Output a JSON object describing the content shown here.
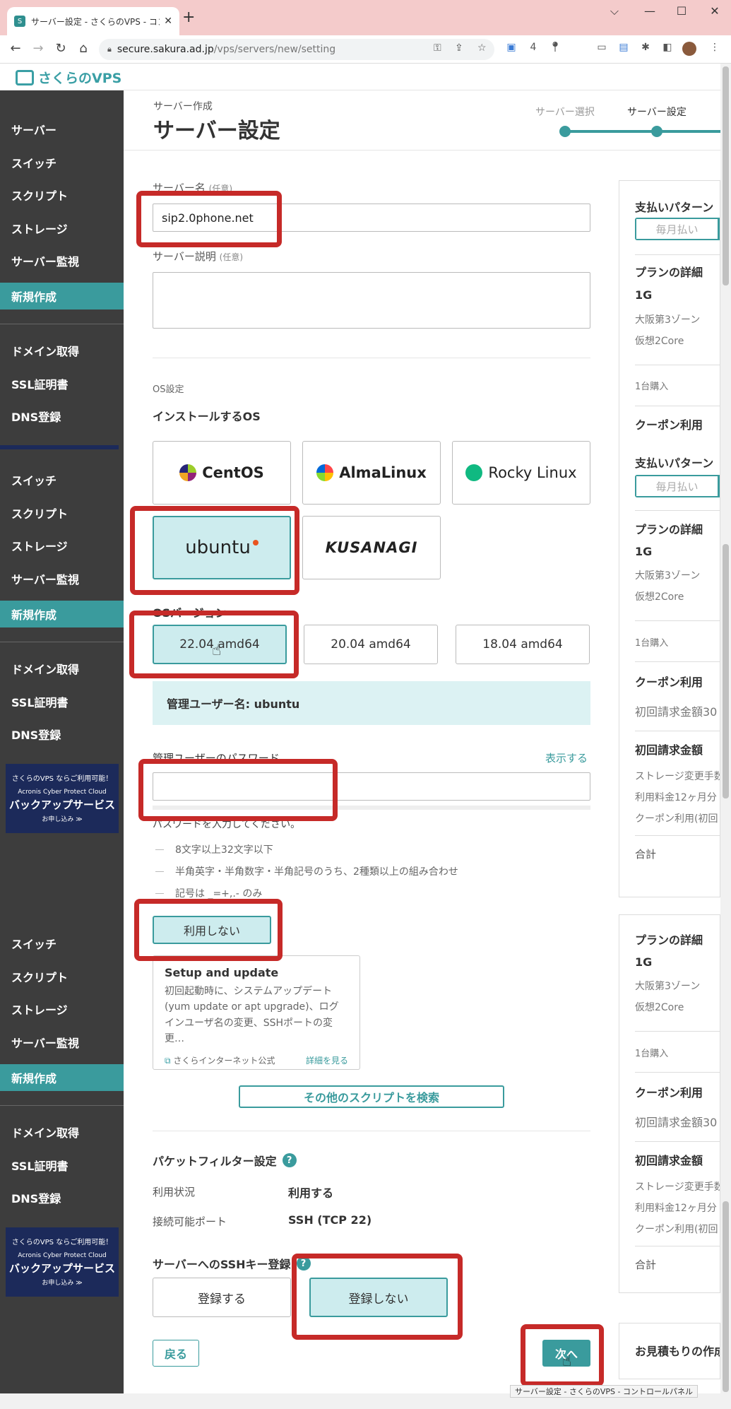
{
  "browser": {
    "tab_title": "サーバー設定 - さくらのVPS - コントロ...",
    "favicon_text": "S",
    "url_host": "secure.sakura.ad.jp",
    "url_path": "/vps/servers/new/setting",
    "new_tab": "+",
    "close": "✕",
    "min": "⌵",
    "minimize": "—",
    "maximize": "☐",
    "exit": "✕"
  },
  "site": {
    "logo": "さくらのVPS"
  },
  "sidebar": {
    "items": [
      "サーバー",
      "スイッチ",
      "スクリプト",
      "ストレージ",
      "サーバー監視",
      "新規作成",
      "ドメイン取得",
      "SSL証明書",
      "DNS登録"
    ],
    "banner": {
      "line1": "さくらのVPS ならご利用可能！",
      "line2": "Acronis Cyber Protect Cloud",
      "line3": "バックアップサービス",
      "line4": "お申し込み ≫"
    }
  },
  "header": {
    "subtitle": "サーバー作成",
    "title": "サーバー設定",
    "steps": [
      "サーバー選択",
      "サーバー設定"
    ]
  },
  "form": {
    "server_name_label": "サーバー名",
    "optional": "(任意)",
    "server_name_value": "sip2.0phone.net",
    "server_desc_label": "サーバー説明",
    "os_section": "OS設定",
    "os_install_label": "インストールするOS",
    "os_options": [
      "CentOS",
      "AlmaLinux",
      "Rocky Linux",
      "ubuntu",
      "KUSANAGI"
    ],
    "os_version_label": "OSバージョン",
    "os_versions": [
      "22.04 amd64",
      "20.04 amd64",
      "18.04 amd64"
    ],
    "admin_user": "管理ユーザー名: ubuntu",
    "password_label": "管理ユーザーのパスワード",
    "show_password": "表示する",
    "password_hint": "パスワードを入力してください。",
    "password_rules": [
      "8文字以上32文字以下",
      "半角英字・半角数字・半角記号のうち、2種類以上の組み合わせ",
      "記号は _=+,.- のみ"
    ],
    "script_toggle": "利用しない",
    "script_card": {
      "title": "Setup and update",
      "desc": "初回起動時に、システムアップデート(yum update or apt upgrade)、ログインユーザ名の変更、SSHポートの変更…",
      "publisher": "さくらインターネット公式",
      "detail": "詳細を見る"
    },
    "search_scripts": "その他のスクリプトを検索",
    "packet_filter_label": "パケットフィルター設定",
    "pf_status_key": "利用状況",
    "pf_status_val": "利用する",
    "pf_port_key": "接続可能ポート",
    "pf_port_val": "SSH (TCP 22)",
    "ssh_key_label": "サーバーへのSSHキー登録",
    "ssh_register": "登録する",
    "ssh_no_register": "登録しない",
    "back": "戻る",
    "next": "次へ"
  },
  "right_panel": {
    "payment_pattern": "支払いパターン",
    "monthly": "毎月払い",
    "plan_detail": "プランの詳細",
    "plan": "1G",
    "zone": "大阪第3ゾーン",
    "core": "仮想2Core",
    "qty": "1台購入",
    "coupon": "クーポン利用",
    "coupon_detail": "初回請求金額30",
    "initial_bill": "初回請求金額",
    "bill_rows": [
      "ストレージ変更手数",
      "利用料金12ヶ月分",
      "クーポン利用(初回"
    ],
    "total": "合計",
    "estimate": "お見積もりの作成"
  },
  "statusbar": "サーバー設定 - さくらのVPS - コントロールパネル",
  "colors": {
    "accent": "#3a9b9d",
    "annotation": "#c62a28",
    "sidebar": "#3d3d3d"
  }
}
